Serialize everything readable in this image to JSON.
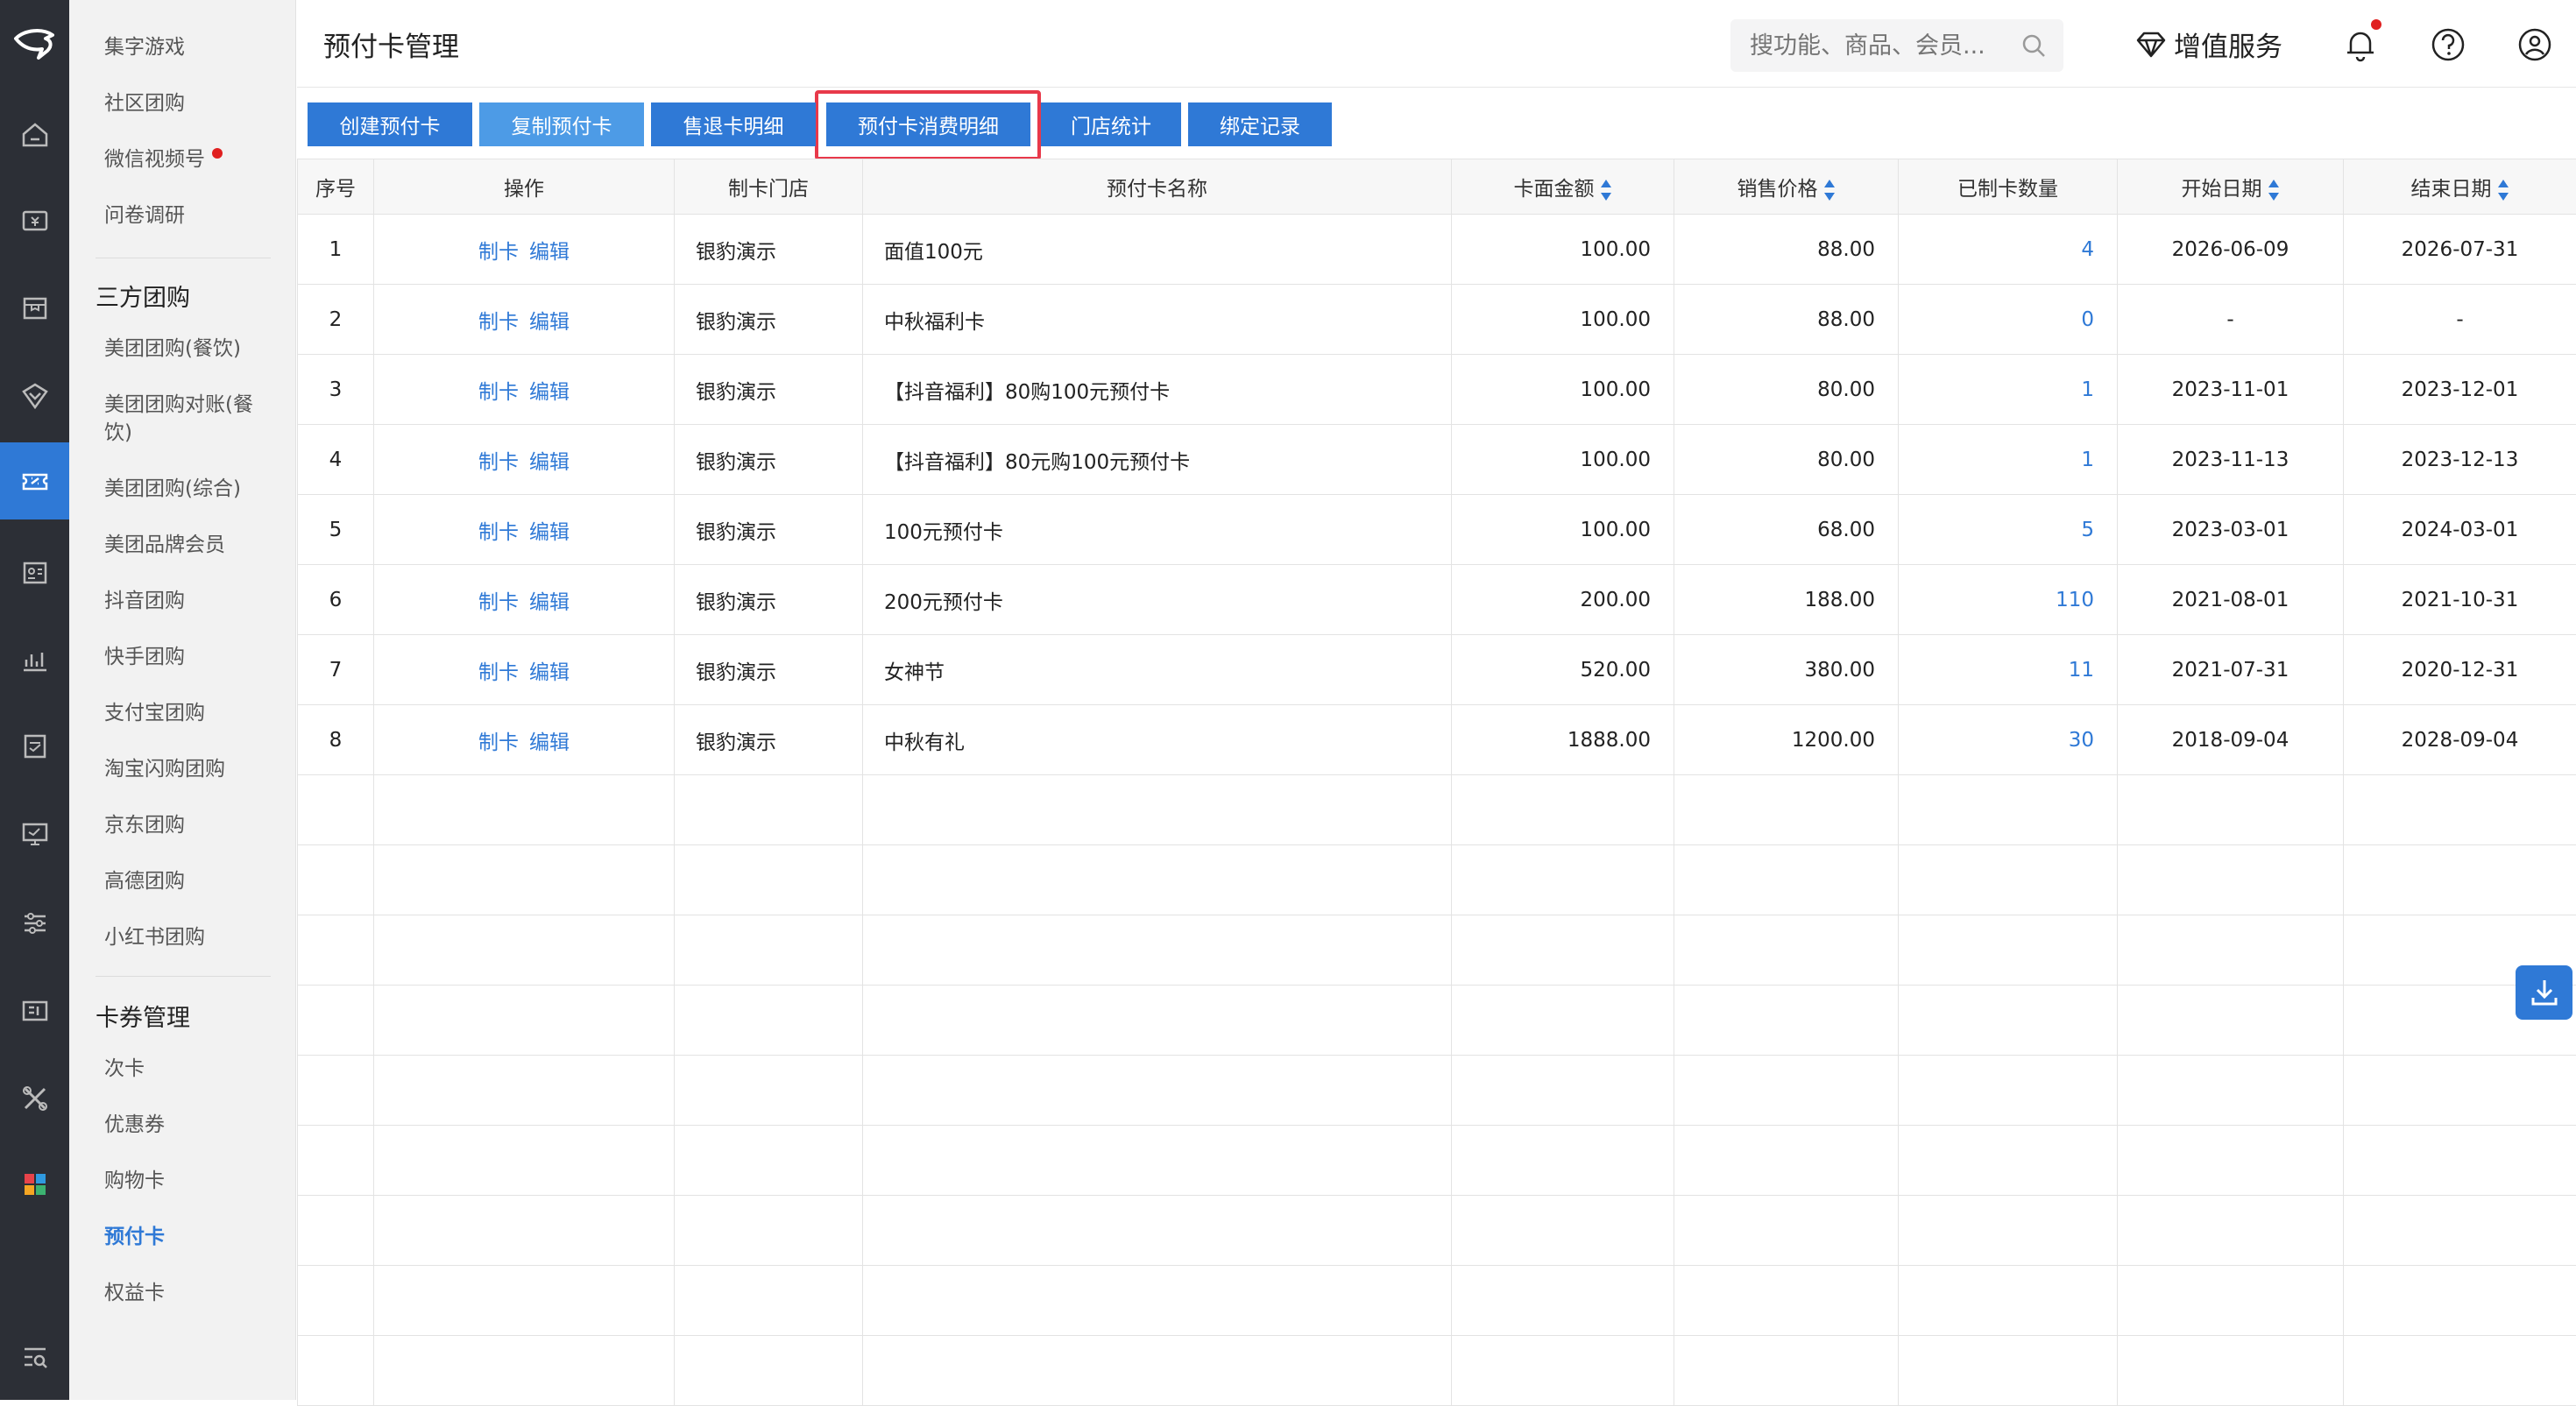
{
  "header": {
    "title": "预付卡管理",
    "search_placeholder": "搜功能、商品、会员...",
    "vip_label": "增值服务"
  },
  "sidebar": {
    "items_top": [
      {
        "label": "集字游戏"
      },
      {
        "label": "社区团购"
      },
      {
        "label": "微信视频号",
        "dot": true
      },
      {
        "label": "问卷调研"
      }
    ],
    "group1": "三方团购",
    "group1_items": [
      {
        "label": "美团团购(餐饮)"
      },
      {
        "label": "美团团购对账(餐"
      },
      {
        "label": "饮)"
      },
      {
        "label": "美团团购(综合)"
      },
      {
        "label": "美团品牌会员"
      },
      {
        "label": "抖音团购"
      },
      {
        "label": "快手团购"
      },
      {
        "label": "支付宝团购"
      },
      {
        "label": "淘宝闪购团购"
      },
      {
        "label": "京东团购"
      },
      {
        "label": "高德团购"
      },
      {
        "label": "小红书团购"
      }
    ],
    "group2": "卡券管理",
    "group2_items": [
      {
        "label": "次卡"
      },
      {
        "label": "优惠券"
      },
      {
        "label": "购物卡"
      },
      {
        "label": "预付卡",
        "active": true
      },
      {
        "label": "权益卡"
      }
    ]
  },
  "toolbar": {
    "buttons": [
      {
        "label": "创建预付卡"
      },
      {
        "label": "复制预付卡"
      },
      {
        "label": "售退卡明细"
      },
      {
        "label": "预付卡消费明细"
      },
      {
        "label": "门店统计"
      },
      {
        "label": "绑定记录"
      }
    ]
  },
  "table": {
    "headers": [
      "序号",
      "操作",
      "制卡门店",
      "预付卡名称",
      "卡面金额",
      "销售价格",
      "已制卡数量",
      "开始日期",
      "结束日期"
    ],
    "action_make": "制卡",
    "action_edit": "编辑",
    "rows": [
      {
        "no": "1",
        "store": "银豹演示",
        "name": "面值100元",
        "face": "100.00",
        "price": "88.00",
        "count": "4",
        "start": "2026-06-09",
        "end": "2026-07-31"
      },
      {
        "no": "2",
        "store": "银豹演示",
        "name": "中秋福利卡",
        "face": "100.00",
        "price": "88.00",
        "count": "0",
        "start": "-",
        "end": "-"
      },
      {
        "no": "3",
        "store": "银豹演示",
        "name": "【抖音福利】80购100元预付卡",
        "face": "100.00",
        "price": "80.00",
        "count": "1",
        "start": "2023-11-01",
        "end": "2023-12-01"
      },
      {
        "no": "4",
        "store": "银豹演示",
        "name": "【抖音福利】80元购100元预付卡",
        "face": "100.00",
        "price": "80.00",
        "count": "1",
        "start": "2023-11-13",
        "end": "2023-12-13"
      },
      {
        "no": "5",
        "store": "银豹演示",
        "name": "100元预付卡",
        "face": "100.00",
        "price": "68.00",
        "count": "5",
        "start": "2023-03-01",
        "end": "2024-03-01"
      },
      {
        "no": "6",
        "store": "银豹演示",
        "name": "200元预付卡",
        "face": "200.00",
        "price": "188.00",
        "count": "110",
        "start": "2021-08-01",
        "end": "2021-10-31"
      },
      {
        "no": "7",
        "store": "银豹演示",
        "name": "女神节",
        "face": "520.00",
        "price": "380.00",
        "count": "11",
        "start": "2021-07-31",
        "end": "2020-12-31"
      },
      {
        "no": "8",
        "store": "银豹演示",
        "name": "中秋有礼",
        "face": "1888.00",
        "price": "1200.00",
        "count": "30",
        "start": "2018-09-04",
        "end": "2028-09-04"
      }
    ]
  },
  "colors": {
    "accent": "#2f79d6",
    "highlight": "#e8394a",
    "rail": "#2c2f36"
  }
}
